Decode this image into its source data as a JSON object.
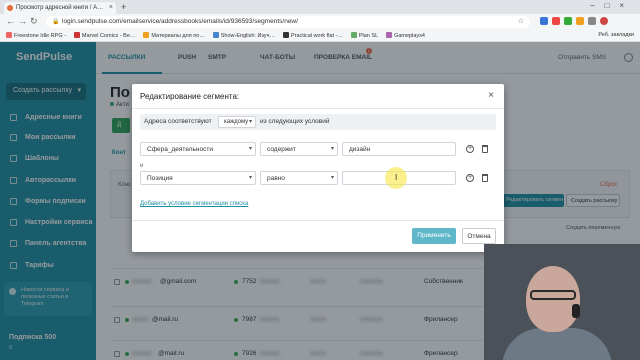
{
  "browser": {
    "tab_title": "Просмотр адресной книги / А…",
    "url": "login.sendpulse.com/emailservice/addressbooks/emails/id/936593/segments/new/",
    "bookmarks": [
      "Freestone Idle RPG -",
      "Marvel Comics - Ве…",
      "Материалы для по…",
      "Show-English: Изуч…",
      "Practical work flat -…",
      "Plan SL",
      "Gameplays4"
    ],
    "bookmarks_right": "Реб. закладки"
  },
  "sidebar": {
    "logo": "SendPulse",
    "create_label": "Создать рассылку",
    "items": [
      {
        "label": "Адресные книги",
        "icon": "book-icon"
      },
      {
        "label": "Мои рассылки",
        "icon": "mail-icon"
      },
      {
        "label": "Шаблоны",
        "icon": "template-icon"
      },
      {
        "label": "Авторассылки",
        "icon": "automation-icon"
      },
      {
        "label": "Формы подписки",
        "icon": "form-icon"
      },
      {
        "label": "Настройки сервиса",
        "icon": "settings-icon"
      },
      {
        "label": "Панель агентства",
        "icon": "agency-icon"
      },
      {
        "label": "Тарифы",
        "icon": "pricing-icon"
      }
    ],
    "promo": "Новости сервиса и полезные статьи в Telegram",
    "subscribers": "Подписка 500",
    "subscribers_sub": "0"
  },
  "topnav": {
    "items": [
      "РАССЫЛКИ",
      "PUSH",
      "SMTP",
      "ЧАТ-БОТЫ",
      "ПРОВЕРКА EMAIL"
    ],
    "badge": "1",
    "sms": "Отправить SMS"
  },
  "page": {
    "title": "По",
    "status": "Акти",
    "add_btn": "Д",
    "tab": "Конт",
    "panel_label": "Конс",
    "save_segment": "Редактировать сегмент",
    "create_mailing": "Создать рассылку",
    "reset": "Сброс",
    "create_variable": "Создать переменную"
  },
  "rows": [
    {
      "email": "@gmail.com",
      "phone": "7752",
      "role": "Собственник"
    },
    {
      "email": "@mail.ru",
      "phone": "7987",
      "role": "Фрилансер"
    },
    {
      "email": "@mail.ru",
      "phone": "7926",
      "role": "Фрилансер"
    }
  ],
  "modal": {
    "title": "Редактирование сегмента:",
    "cond_prefix": "Адреса соответствуют",
    "cond_select": "каждому",
    "cond_suffix": "из следующих условий",
    "conditions": [
      {
        "field": "Сфера_деятельности",
        "operator": "содержит",
        "value": "дизайн"
      },
      {
        "field": "Позиция",
        "operator": "равно",
        "value": ""
      }
    ],
    "and_label": "и",
    "add_condition": "Добавить условие сегментации списка",
    "apply": "Применить",
    "cancel": "Отмена"
  },
  "colors": {
    "brand": "#1e8fa3",
    "apply": "#5fb8c9",
    "accent_red": "#f0644a"
  }
}
